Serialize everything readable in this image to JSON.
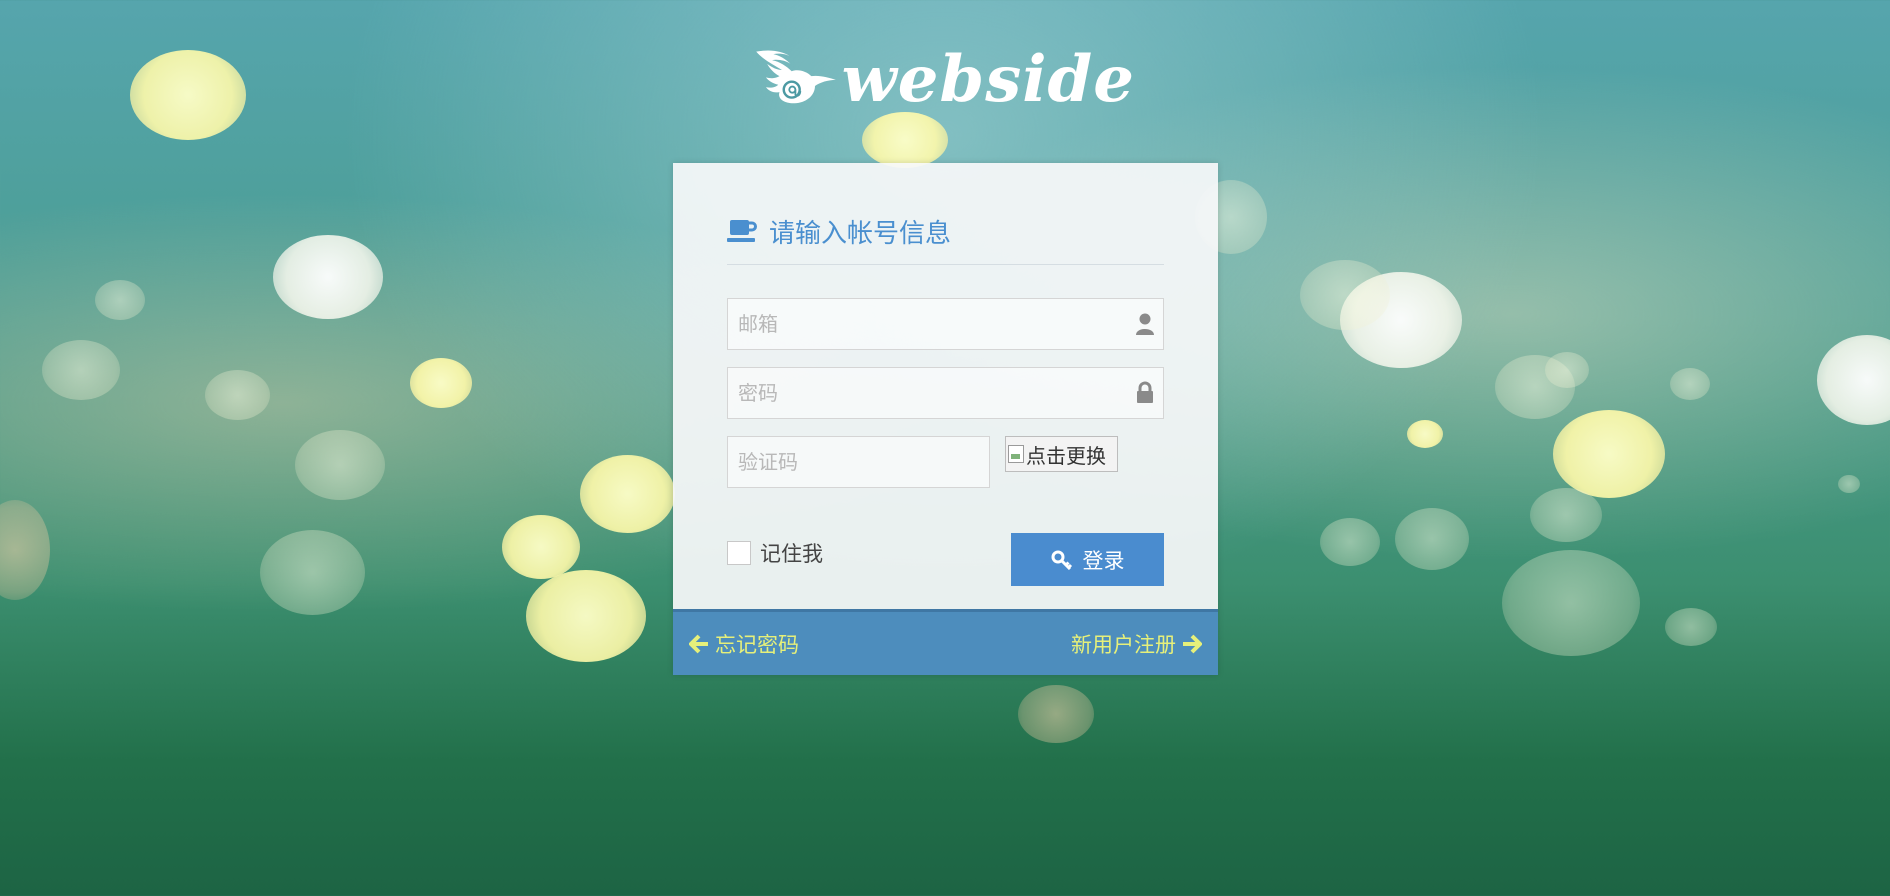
{
  "brand": {
    "logo_text": "webside"
  },
  "login_form": {
    "title": "请输入帐号信息",
    "email": {
      "placeholder": "邮箱",
      "value": ""
    },
    "password": {
      "placeholder": "密码",
      "value": ""
    },
    "captcha": {
      "placeholder": "验证码",
      "value": "",
      "image_alt": "点击更换"
    },
    "remember_label": "记住我",
    "remember_checked": false,
    "login_button": "登录"
  },
  "footer": {
    "forgot_password": "忘记密码",
    "register": "新用户注册"
  },
  "icons": {
    "title": "coffee-cup-icon",
    "email": "user-icon",
    "password": "lock-icon",
    "login": "key-icon",
    "forgot": "arrow-left-icon",
    "register": "arrow-right-icon"
  },
  "colors": {
    "accent": "#4a8ccf",
    "footer_bg": "#4d8dbd",
    "footer_text": "#e6f07a"
  }
}
